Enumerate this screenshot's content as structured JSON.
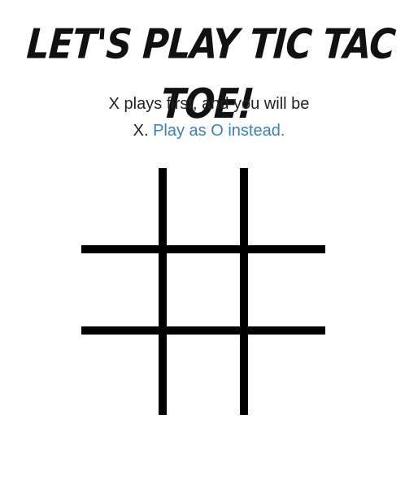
{
  "title": "Let's Play Tic Tac Toe!",
  "intro": {
    "line1": "X plays first, and you will be",
    "line2_prefix": "X.",
    "switch_link": "Play as O instead."
  },
  "colors": {
    "link": "#3a7fbd",
    "grid": "#000000"
  },
  "board": {
    "cells": [
      "",
      "",
      "",
      "",
      "",
      "",
      "",
      "",
      ""
    ]
  }
}
